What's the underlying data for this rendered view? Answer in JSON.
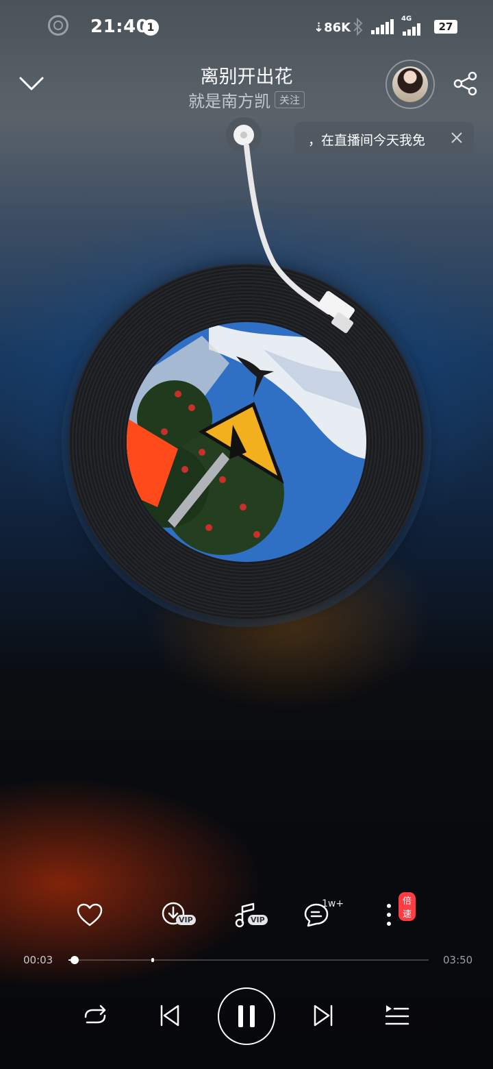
{
  "status_bar": {
    "time": "21:40",
    "notification_count": "1",
    "net_speed": "86K",
    "network_type": "4G",
    "battery": "27"
  },
  "song": {
    "title": "离别开出花",
    "artist": "就是南方凯",
    "follow_label": "关注"
  },
  "live_tip": {
    "text": "，在直播间今天我免"
  },
  "actions": {
    "vip_badge": "VIP",
    "comment_count": "1w+",
    "speed_label": "倍速"
  },
  "progress": {
    "current": "00:03",
    "total": "03:50",
    "played_fraction": 0.013,
    "buffered_fraction": 0.23
  },
  "colors": {
    "accent_red": "#ff3b44",
    "record_blue": "#1a4a7a"
  },
  "icons": [
    "collapse-chevron-icon",
    "share-icon",
    "close-icon",
    "heart-icon",
    "download-icon",
    "ringtone-icon",
    "comment-icon",
    "more-icon",
    "repeat-icon",
    "previous-icon",
    "pause-icon",
    "next-icon",
    "playlist-icon"
  ]
}
